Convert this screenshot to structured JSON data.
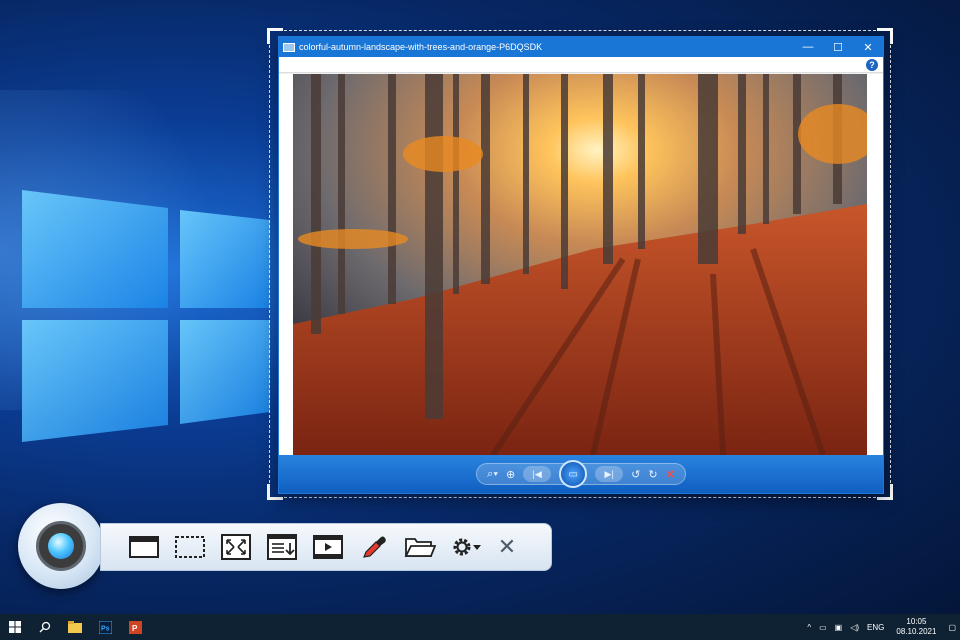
{
  "photo_window": {
    "title": "colorful-autumn-landscape-with-trees-and-orange-P6DQSDK",
    "minimize_glyph": "—",
    "maximize_glyph": "☐",
    "close_glyph": "✕",
    "help_glyph": "?",
    "controls": {
      "zoom": "⌕▾",
      "actual_size": "⊕",
      "prev": "|◀",
      "slideshow": "▭",
      "next": "▶|",
      "rotate_ccw": "↺",
      "rotate_cw": "↻",
      "delete": "✕"
    }
  },
  "capture_toolbar": {
    "close_glyph": "✕",
    "tools": [
      "capture-window",
      "capture-region",
      "capture-fullscreen",
      "capture-scrolling",
      "record-video",
      "color-picker",
      "open-folder",
      "settings"
    ]
  },
  "taskbar": {
    "tray_chevron": "^",
    "language": "ENG",
    "time": "10:05",
    "date": "08.10.2021"
  },
  "colors": {
    "accent": "#1976d6",
    "taskbar": "#0f2233"
  }
}
